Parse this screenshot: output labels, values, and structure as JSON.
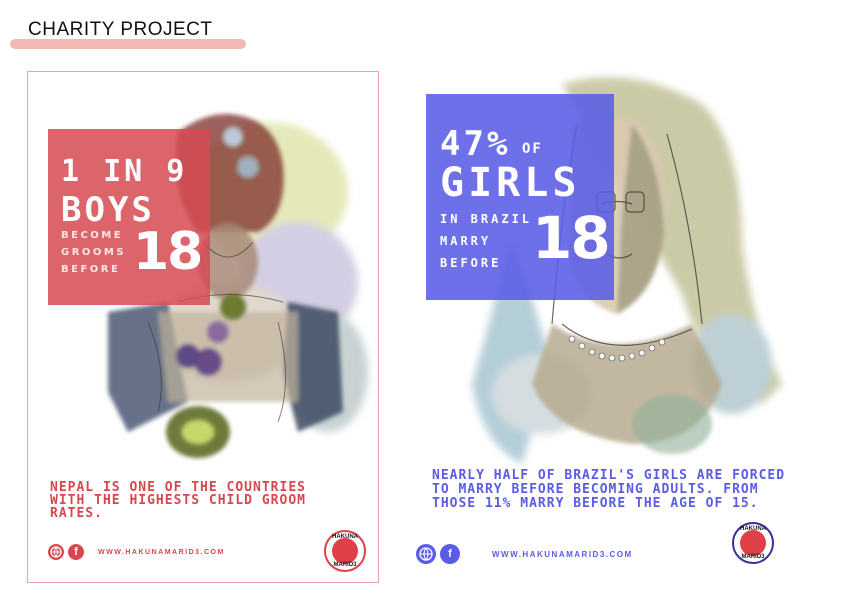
{
  "header": {
    "title": "CHARITY  PROJECT"
  },
  "poster_nepal": {
    "line1": "1 IN 9",
    "line2": "BOYS",
    "small1": "BECOME",
    "small2": "GROOMS",
    "small3": "BEFORE",
    "number": "18",
    "body": "NEPAL IS ONE OF THE COUNTRIES WITH THE HIGHESTS CHILD GROOM RATES.",
    "url": "WWW.HAKUNAMARID3.COM",
    "badge_top": "HAKUNA",
    "badge_bottom": "MARID3",
    "accent": "#d6484e"
  },
  "poster_brazil": {
    "percent": "47%",
    "of": "OF",
    "line2": "GIRLS",
    "small1": "IN BRAZIL",
    "small2": "MARRY",
    "small3": "BEFORE",
    "number": "18",
    "body": "NEARLY HALF OF BRAZIL'S GIRLS ARE FORCED TO MARRY BEFORE BECOMING ADULTS. FROM THOSE 11% MARRY BEFORE THE AGE OF 15.",
    "url": "WWW.HAKUNAMARID3.COM",
    "badge_top": "HAKUNA",
    "badge_bottom": "MARID3",
    "accent": "#5a5ce6"
  },
  "icons": [
    "globe-icon",
    "facebook-icon",
    "hakuna-marid3-logo-icon"
  ]
}
